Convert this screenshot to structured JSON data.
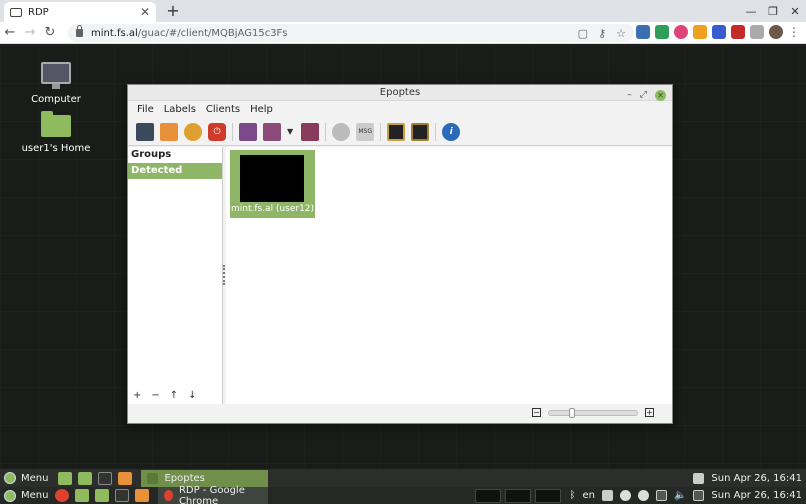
{
  "browser": {
    "tab_title": "RDP",
    "url_host": "mint.fs.al",
    "url_path": "/guac/#/client/MQBjAG15c3Fs",
    "new_tab_symbol": "+",
    "tab_close_symbol": "✕"
  },
  "desktop": {
    "icons": [
      {
        "label": "Computer"
      },
      {
        "label": "user1's Home"
      }
    ]
  },
  "epoptes": {
    "title": "Epoptes",
    "menu": [
      "File",
      "Labels",
      "Clients",
      "Help"
    ],
    "sidebar": {
      "groups_label": "Groups",
      "detected_label": "Detected clients",
      "actions": [
        "+",
        "−",
        "↑",
        "↓"
      ]
    },
    "client": {
      "label": "mint.fs.al (user12)"
    },
    "zoom": {
      "out": "−",
      "in": "+"
    }
  },
  "taskbar_top": {
    "menu_label": "Menu",
    "active_task": "Epoptes",
    "clock": "Sun Apr 26, 16:41"
  },
  "taskbar_bottom": {
    "menu_label": "Menu",
    "active_task": "RDP - Google Chrome",
    "lang": "en",
    "clock": "Sun Apr 26, 16:41"
  },
  "colors": {
    "accent_green": "#8fb567",
    "desktop_bg": "#191c19"
  }
}
